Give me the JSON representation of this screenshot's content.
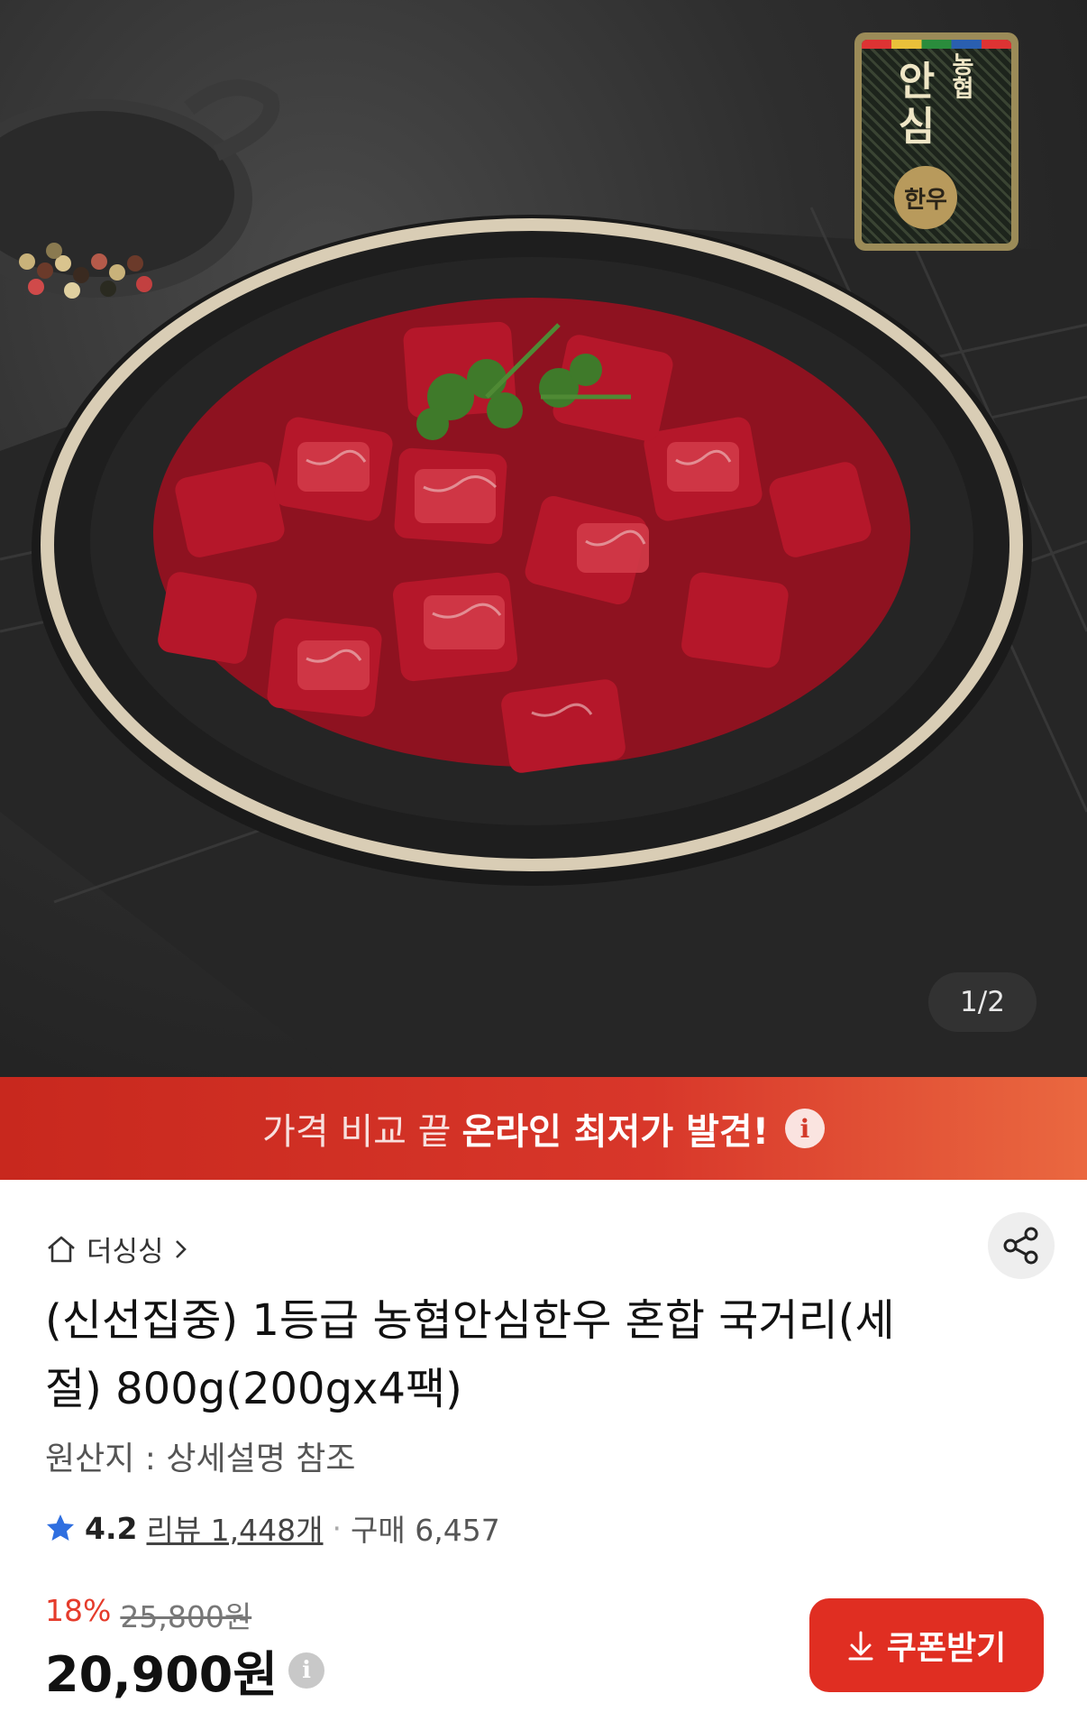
{
  "hero": {
    "page_indicator": "1/2",
    "badge": {
      "line1": "농협",
      "line2": "안심",
      "circle": "한우"
    }
  },
  "banner": {
    "prefix": "가격 비교 끝",
    "highlight": "온라인 최저가 발견!",
    "info_icon": "i"
  },
  "product": {
    "store": "더싱싱",
    "title": "(신선집중) 1등급 농협안심한우  혼합 국거리(세절) 800g(200gx4팩)",
    "origin": "원산지 : 상세설명 참조",
    "rating": "4.2",
    "review_label": "리뷰 1,448개",
    "purchase_label": "구매 6,457",
    "discount": "18%",
    "original_price": "25,800원",
    "price": "20,900원",
    "price_info_icon": "i",
    "coupon_label": "쿠폰받기"
  },
  "icons": {
    "home": "home-icon",
    "chevron": "chevron-right-icon",
    "share": "share-icon",
    "star": "star-icon",
    "download": "download-icon"
  },
  "colors": {
    "accent": "#e02e22",
    "banner_start": "#c8281e",
    "banner_end": "#ea6840",
    "star": "#2f6fe0"
  }
}
